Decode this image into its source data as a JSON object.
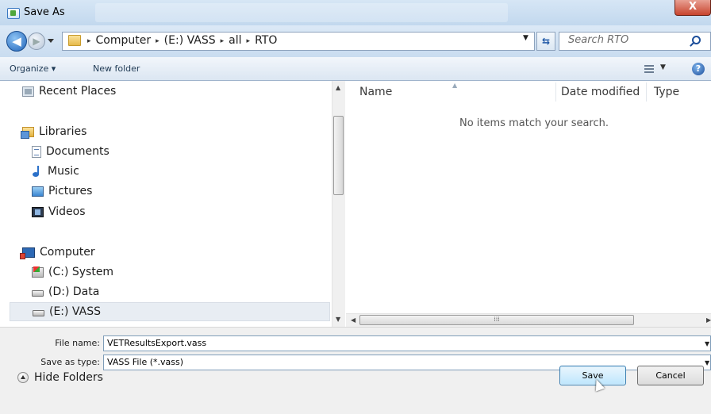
{
  "window": {
    "title": "Save As",
    "close_glyph": "X"
  },
  "address_bar": {
    "crumbs": [
      "Computer",
      "(E:) VASS",
      "all",
      "RTO"
    ],
    "separator": "▸"
  },
  "search": {
    "placeholder": "Search RTO"
  },
  "toolbar": {
    "organize": "Organize ▾",
    "new_folder": "New folder",
    "help": "?"
  },
  "nav_pane": {
    "recent_places": "Recent Places",
    "libraries": "Libraries",
    "documents": "Documents",
    "music": "Music",
    "pictures": "Pictures",
    "videos": "Videos",
    "computer": "Computer",
    "drive_c": "(C:) System",
    "drive_d": "(D:) Data",
    "drive_e": "(E:) VASS"
  },
  "file_pane": {
    "columns": {
      "name": "Name",
      "date_modified": "Date modified",
      "type": "Type"
    },
    "empty_message": "No items match your search."
  },
  "form": {
    "file_name_label": "File name:",
    "file_name_value": "VETResultsExport.vass",
    "save_type_label": "Save as type:",
    "save_type_value": "VASS File (*.vass)"
  },
  "footer": {
    "hide_folders": "Hide Folders",
    "save": "Save",
    "cancel": "Cancel"
  },
  "colors": {
    "selection": "#e8edf3",
    "titlebar": "#c2d8ee",
    "close": "#c8442e"
  }
}
